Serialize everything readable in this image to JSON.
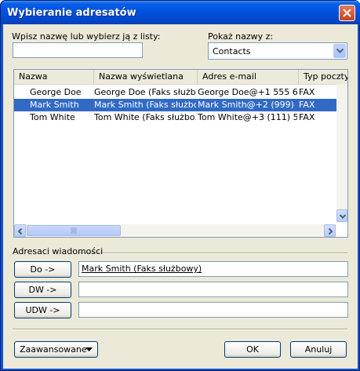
{
  "window": {
    "title": "Wybieranie adresatów"
  },
  "search": {
    "label": "Wpisz nazwę lub wybierz ją z listy:",
    "value": ""
  },
  "show_names": {
    "label": "Pokaż nazwy z:",
    "selected": "Contacts"
  },
  "table": {
    "columns": [
      "Nazwa",
      "Nazwa wyświetlana",
      "Adres e-mail",
      "Typ poczty"
    ],
    "rows": [
      {
        "name": "George Doe",
        "display": "George Doe (Faks służb...",
        "email": "George Doe@+1 555 6...",
        "type": "FAX",
        "selected": false
      },
      {
        "name": "Mark Smith",
        "display": "Mark Smith (Faks służbo...",
        "email": "Mark Smith@+2 (999) 8...",
        "type": "FAX",
        "selected": true
      },
      {
        "name": "Tom White",
        "display": "Tom White (Faks służbo...",
        "email": "Tom White@+3 (111) 5...",
        "type": "FAX",
        "selected": false
      }
    ]
  },
  "recipients": {
    "label": "Adresaci wiadomości",
    "to": {
      "button": "Do ->",
      "value": "Mark Smith (Faks służbowy)"
    },
    "cc": {
      "button": "DW ->",
      "value": ""
    },
    "bcc": {
      "button": "UDW ->",
      "value": ""
    }
  },
  "footer": {
    "advanced": "Zaawansowane",
    "ok": "OK",
    "cancel": "Anuluj"
  }
}
